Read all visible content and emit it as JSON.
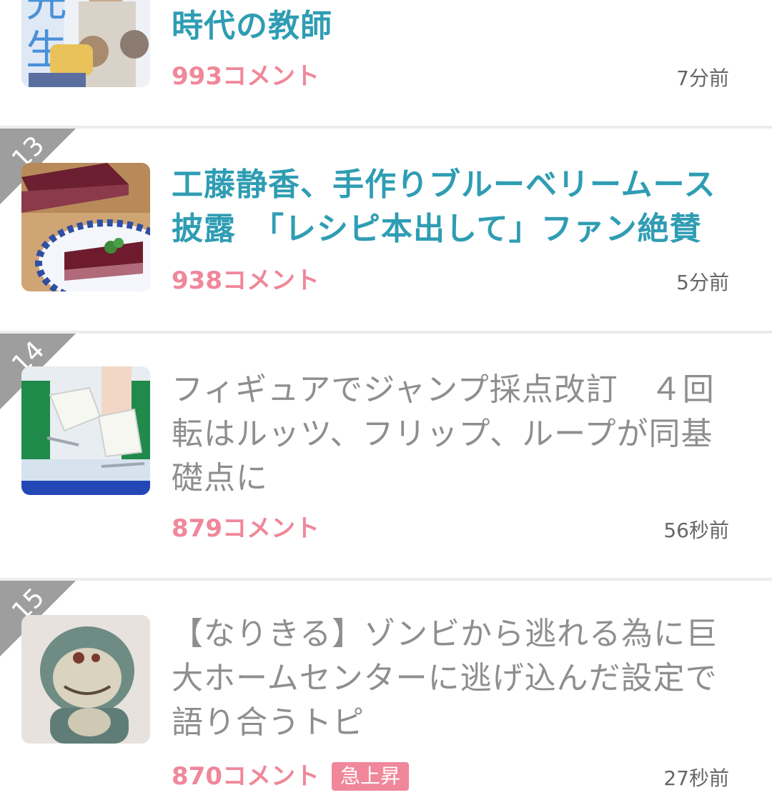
{
  "topics": [
    {
      "rank": "",
      "title": "時代の教師",
      "comments": "993コメント",
      "time": "7分前",
      "read": false,
      "thumbnail": "manga-cover-image"
    },
    {
      "rank": "13",
      "title": "工藤静香、手作りブルーベリームース披露　「レシピ本出して」ファン絶賛",
      "comments": "938コメント",
      "time": "5分前",
      "read": false,
      "thumbnail": "blueberry-mousse-image"
    },
    {
      "rank": "14",
      "title": "フィギュアでジャンプ採点改訂　４回転はルッツ、フリップ、ループが同基礎点に",
      "comments": "879コメント",
      "time": "56秒前",
      "read": true,
      "thumbnail": "figure-skate-image"
    },
    {
      "rank": "15",
      "title": "【なりきる】ゾンビから逃れる為に巨大ホームセンターに逃げ込んだ設定で語り合うトピ",
      "comments": "870コメント",
      "badge": "急上昇",
      "time": "27秒前",
      "read": true,
      "thumbnail": "worn-plush-toy-image"
    }
  ],
  "colors": {
    "title_unread": "#2f9db3",
    "title_read": "#8e8e8e",
    "comments": "#f0879a",
    "badge_bg": "#f0879a",
    "rank_ribbon": "#9e9e9e",
    "divider": "#ececec",
    "time": "#666666"
  }
}
